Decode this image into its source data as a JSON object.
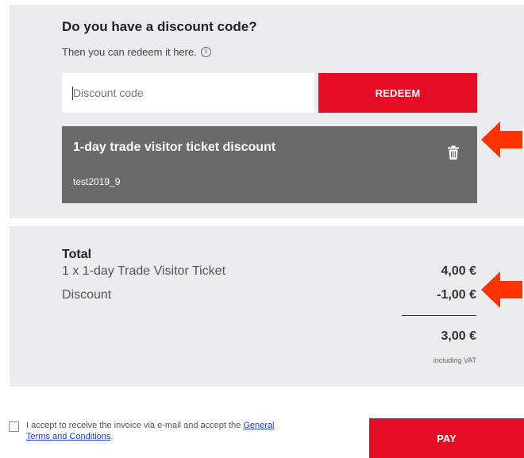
{
  "discount": {
    "title": "Do you have a discount code?",
    "subtitle": "Then you can redeem it here.",
    "info_icon_glyph": "i",
    "input_placeholder": "Discount code",
    "input_value": "",
    "redeem_label": "REDEEM",
    "applied": {
      "title": "1-day trade visitor ticket discount",
      "code": "test2019_9",
      "delete_icon": "trash-icon"
    }
  },
  "summary": {
    "total_label": "Total",
    "lines": [
      {
        "label": "1 x 1-day Trade Visitor Ticket",
        "value": "4,00 €"
      },
      {
        "label": "Discount",
        "value": "-1,00 €"
      }
    ],
    "total_value": "3,00 €",
    "vat_note": "including VAT"
  },
  "terms": {
    "text_before": "I accept to receive the invoice via e-mail and accept the ",
    "link_text": "General Terms and Conditions",
    "text_after": ".",
    "checked": false
  },
  "pay_label": "PAY",
  "colors": {
    "accent": "#e30e25",
    "panel_bg": "#ececee",
    "applied_bg": "#6a6a6a",
    "arrow": "#ff3300",
    "link": "#1a3fd1"
  }
}
